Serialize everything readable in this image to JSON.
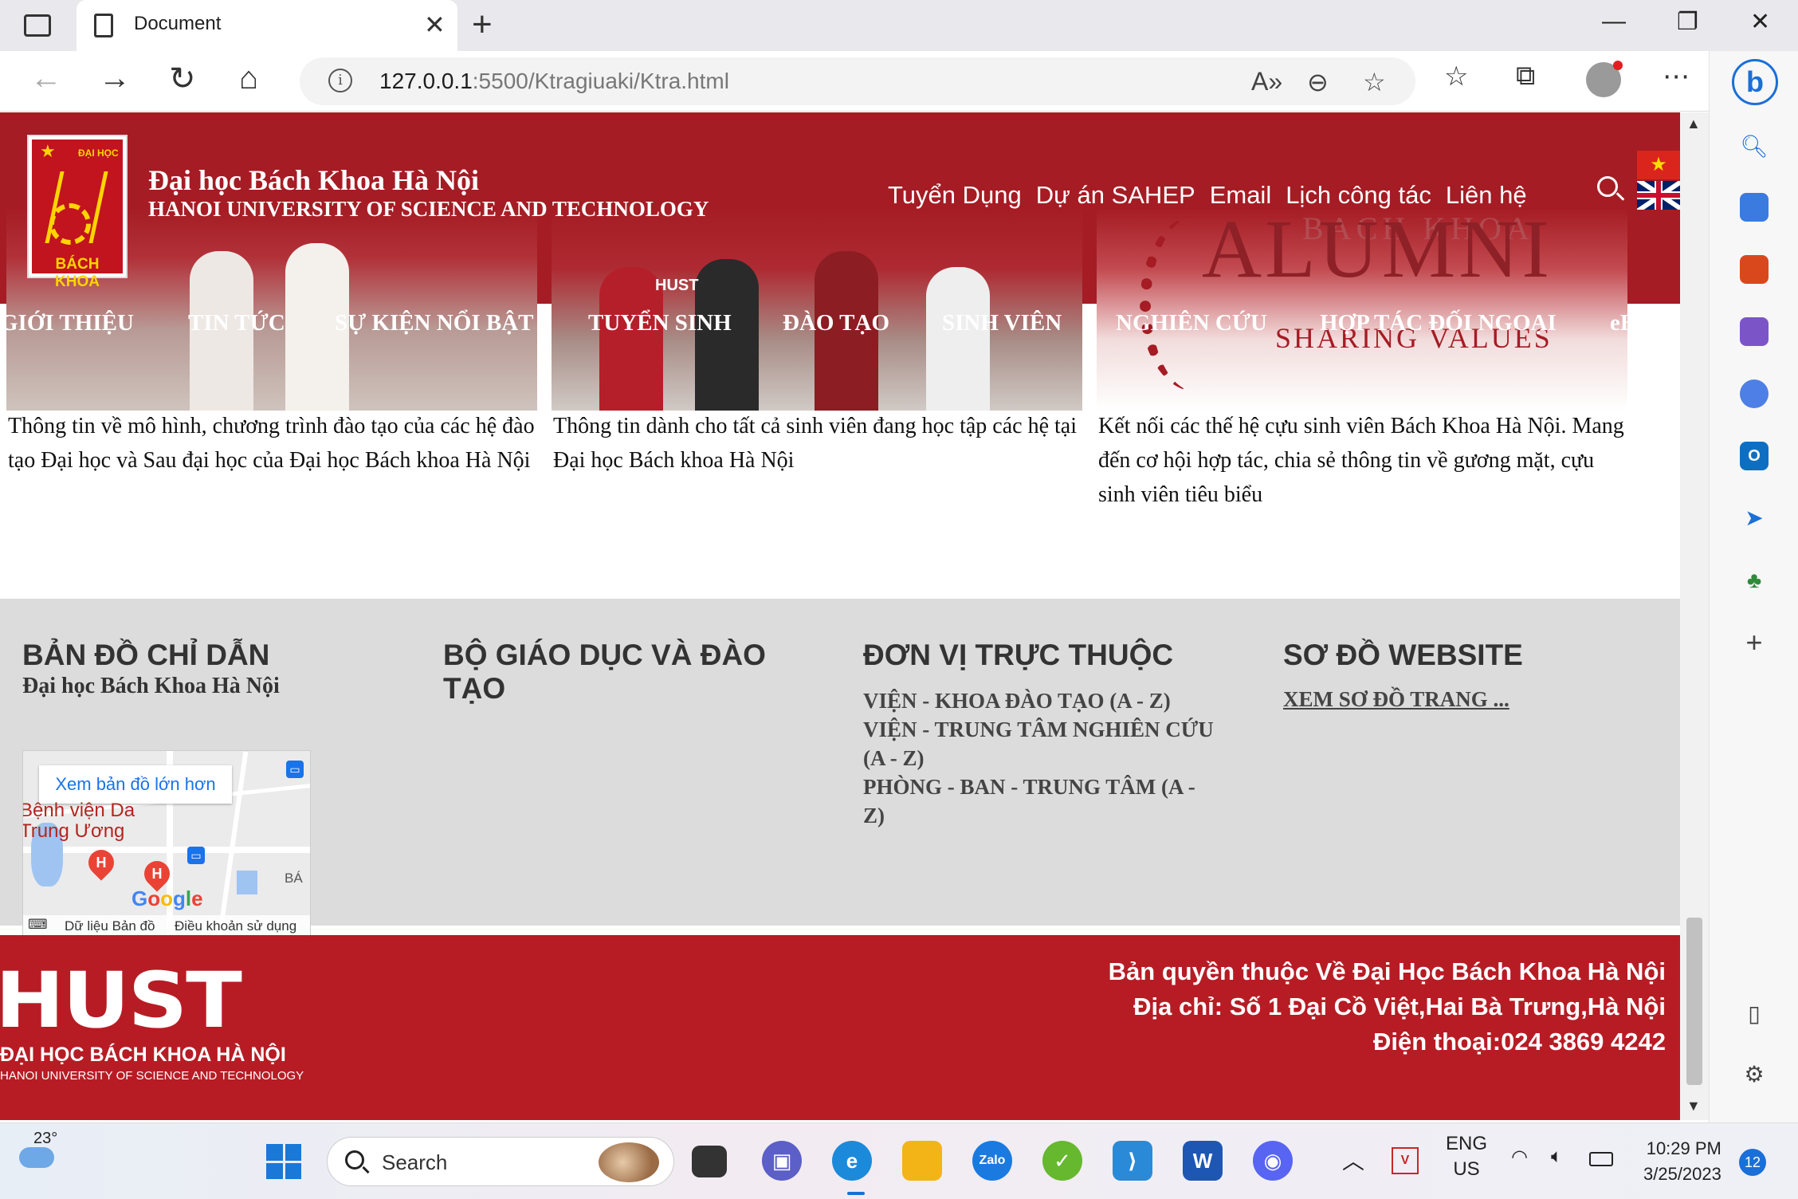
{
  "browser": {
    "tab_title": "Document",
    "url_host": "127.0.0.1",
    "url_path": ":5500/Ktragiuaki/Ktra.html"
  },
  "header": {
    "logo_top": "ĐẠI HỌC",
    "logo_bottom": "BÁCH KHOA",
    "title_vn": "Đại học Bách Khoa Hà Nội",
    "title_en": "HANOI UNIVERSITY OF SCIENCE AND TECHNOLOGY",
    "top_links": [
      "Tuyển Dụng",
      "Dự án SAHEP",
      "Email",
      "Lịch công tác",
      "Liên hệ"
    ]
  },
  "nav": [
    "GIỚI THIỆU",
    "TIN TỨC",
    "SỰ KIỆN NỔI BẬT",
    "TUYỂN SINH",
    "ĐÀO TẠO",
    "SINH VIÊN",
    "NGHIÊN CỨU",
    "HỢP TÁC ĐỐI NGOẠI",
    "eHUST"
  ],
  "cards": [
    {
      "text": "Thông tin về mô hình, chương trình đào tạo của các hệ đào tạo Đại học và Sau đại học của Đại học Bách khoa Hà Nội"
    },
    {
      "text": "Thông tin dành cho tất cả sinh viên đang học tập các hệ tại Đại học Bách khoa Hà Nội",
      "shirt_text": "HUST"
    },
    {
      "text": "Kết nối các thế hệ cựu sinh viên Bách Khoa Hà Nội. Mang đến cơ hội hợp tác, chia sẻ thông tin về gương mặt, cựu sinh viên tiêu biểu",
      "image_top": "BACH KHOA",
      "image_main": "ALUMNI",
      "image_sub": "SHARING VALUES"
    }
  ],
  "info": {
    "map_col": {
      "heading": "BẢN ĐỒ CHỈ DẪN",
      "sub": "Đại học Bách Khoa Hà Nội",
      "map_button": "Xem bản đồ lớn hơn",
      "hospital_line1": "Bệnh viện Da",
      "hospital_line2": "Trung Ương",
      "map_edge_label": "BÁ",
      "map_data": "Dữ liệu Bản đồ",
      "map_terms": "Điều khoản sử dụng"
    },
    "ministry_col": {
      "heading": "BỘ GIÁO DỤC VÀ ĐÀO TẠO"
    },
    "units_col": {
      "heading": "ĐƠN VỊ TRỰC THUỘC",
      "links": [
        "VIỆN - KHOA ĐÀO TẠO (A - Z)",
        "VIỆN - TRUNG TÂM NGHIÊN CỨU (A - Z)",
        "PHÒNG - BAN - TRUNG TÂM (A - Z)"
      ]
    },
    "sitemap_col": {
      "heading": "SƠ ĐỒ WEBSITE",
      "link": "XEM SƠ ĐỒ TRANG ..."
    }
  },
  "footer": {
    "logo": "HUST",
    "logo_vn": "ĐẠI HỌC BÁCH KHOA HÀ NỘI",
    "logo_en": "HANOI UNIVERSITY OF SCIENCE AND TECHNOLOGY",
    "lines": [
      "Bản quyền thuộc Về Đại Học Bách Khoa Hà Nội",
      "Địa chỉ: Số 1 Đại Cồ Việt,Hai Bà Trưng,Hà Nội",
      "Điện thoại:024 3869 4242"
    ]
  },
  "taskbar": {
    "temperature": "23°",
    "search_placeholder": "Search",
    "lang_1": "ENG",
    "lang_2": "US",
    "time": "10:29 PM",
    "date": "3/25/2023",
    "notifications": "12"
  }
}
